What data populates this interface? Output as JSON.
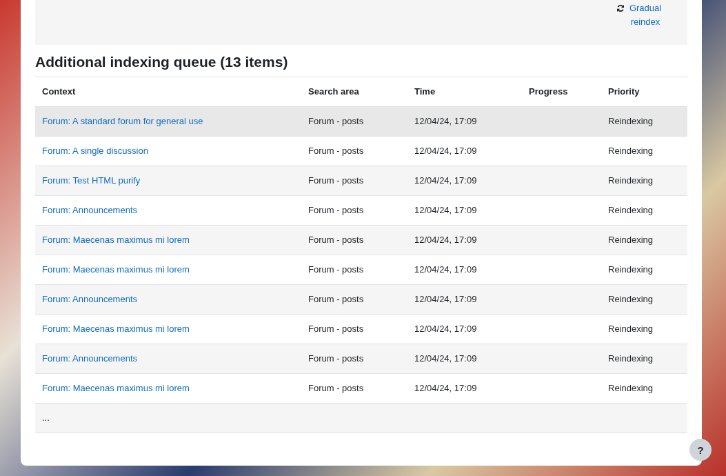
{
  "top_panel": {
    "link": "Gradual reindex"
  },
  "queue": {
    "title": "Additional indexing queue (13 items)",
    "columns": [
      "Context",
      "Search area",
      "Time",
      "Progress",
      "Priority"
    ],
    "rows": [
      {
        "context": "Forum: A standard forum for general use",
        "search_area": "Forum - posts",
        "time": "12/04/24, 17:09",
        "priority": "Reindexing",
        "highlighted": true
      },
      {
        "context": "Forum: A single discussion",
        "search_area": "Forum - posts",
        "time": "12/04/24, 17:09",
        "priority": "Reindexing",
        "highlighted": false
      },
      {
        "context": "Forum: Test HTML purify",
        "search_area": "Forum - posts",
        "time": "12/04/24, 17:09",
        "priority": "Reindexing",
        "highlighted": false
      },
      {
        "context": "Forum: Announcements",
        "search_area": "Forum - posts",
        "time": "12/04/24, 17:09",
        "priority": "Reindexing",
        "highlighted": false
      },
      {
        "context": "Forum: Maecenas maximus mi lorem",
        "search_area": "Forum - posts",
        "time": "12/04/24, 17:09",
        "priority": "Reindexing",
        "highlighted": false
      },
      {
        "context": "Forum: Maecenas maximus mi lorem",
        "search_area": "Forum - posts",
        "time": "12/04/24, 17:09",
        "priority": "Reindexing",
        "highlighted": false
      },
      {
        "context": "Forum: Announcements",
        "search_area": "Forum - posts",
        "time": "12/04/24, 17:09",
        "priority": "Reindexing",
        "highlighted": false
      },
      {
        "context": "Forum: Maecenas maximus mi lorem",
        "search_area": "Forum - posts",
        "time": "12/04/24, 17:09",
        "priority": "Reindexing",
        "highlighted": false
      },
      {
        "context": "Forum: Announcements",
        "search_area": "Forum - posts",
        "time": "12/04/24, 17:09",
        "priority": "Reindexing",
        "highlighted": false
      },
      {
        "context": "Forum: Maecenas maximus mi lorem",
        "search_area": "Forum - posts",
        "time": "12/04/24, 17:09",
        "priority": "Reindexing",
        "highlighted": false
      }
    ],
    "more": "..."
  },
  "help_button": "?"
}
